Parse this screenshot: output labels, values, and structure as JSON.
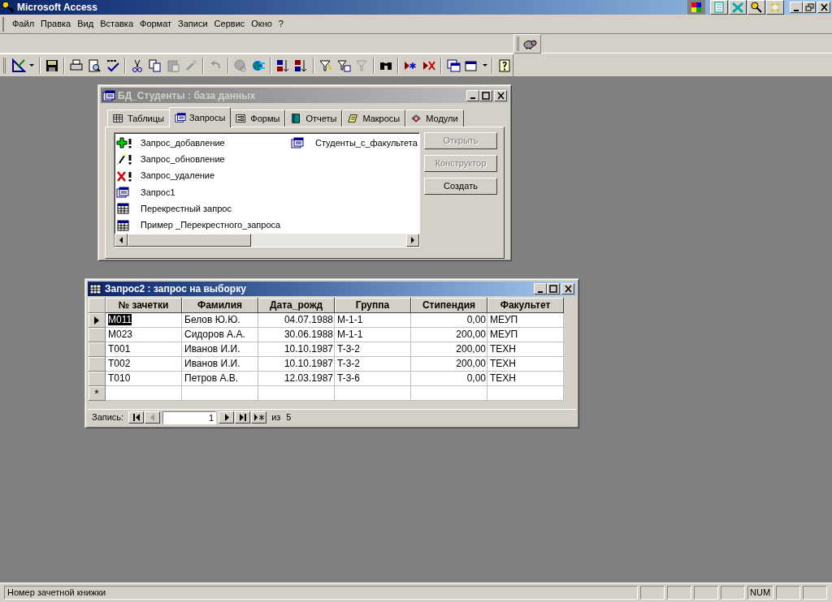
{
  "window": {
    "title": "Microsoft Access"
  },
  "menu": [
    "Файл",
    "Правка",
    "Вид",
    "Вставка",
    "Формат",
    "Записи",
    "Сервис",
    "Окно",
    "?"
  ],
  "db_window": {
    "title": "БД_Студенты : база данных",
    "tabs": [
      {
        "label": "Таблицы",
        "selected": false,
        "kind": "table"
      },
      {
        "label": "Запросы",
        "selected": true,
        "kind": "query"
      },
      {
        "label": "Формы",
        "selected": false,
        "kind": "form"
      },
      {
        "label": "Отчеты",
        "selected": false,
        "kind": "report"
      },
      {
        "label": "Макросы",
        "selected": false,
        "kind": "macro"
      },
      {
        "label": "Модули",
        "selected": false,
        "kind": "module"
      }
    ],
    "objects": [
      {
        "label": "Запрос_добавление",
        "kind": "append"
      },
      {
        "label": "Запрос_обновление",
        "kind": "update"
      },
      {
        "label": "Запрос_удаление",
        "kind": "delete"
      },
      {
        "label": "Запрос1",
        "kind": "select"
      },
      {
        "label": "Перекрестный запрос",
        "kind": "crosstab"
      },
      {
        "label": "Пример _Перекрестного_запроса",
        "kind": "crosstab"
      },
      {
        "label": "Студенты_с_факультета",
        "kind": "select"
      }
    ],
    "buttons": [
      {
        "label": "Открыть",
        "disabled": true
      },
      {
        "label": "Конструктор",
        "disabled": true
      },
      {
        "label": "Создать",
        "disabled": false
      }
    ]
  },
  "query_window": {
    "title": "Запрос2 : запрос на выборку",
    "columns": [
      {
        "label": "№ зачетки",
        "kind": "text"
      },
      {
        "label": "Фамилия",
        "kind": "text"
      },
      {
        "label": "Дата_рожд",
        "kind": "number"
      },
      {
        "label": "Группа",
        "kind": "text"
      },
      {
        "label": "Стипендия",
        "kind": "number"
      },
      {
        "label": "Факультет",
        "kind": "text"
      }
    ],
    "rows": [
      {
        "selected": true,
        "cells": [
          "M011",
          "Белов Ю.Ю.",
          "04.07.1988",
          "M-1-1",
          "0,00",
          "МЕУП"
        ]
      },
      {
        "selected": false,
        "cells": [
          "M023",
          "Сидоров А.А.",
          "30.06.1988",
          "M-1-1",
          "200,00",
          "МЕУП"
        ]
      },
      {
        "selected": false,
        "cells": [
          "T001",
          "Иванов И.И.",
          "10.10.1987",
          "T-3-2",
          "200,00",
          "ТЕХН"
        ]
      },
      {
        "selected": false,
        "cells": [
          "T002",
          "Иванов И.И.",
          "10.10.1987",
          "T-3-2",
          "200,00",
          "ТЕХН"
        ]
      },
      {
        "selected": false,
        "cells": [
          "T010",
          "Петров А.В.",
          "12.03.1987",
          "T-3-6",
          "0,00",
          "ТЕХН"
        ]
      }
    ],
    "new_row_marker": "*",
    "navigator": {
      "label": "Запись:",
      "current": "1",
      "of": "из",
      "total": "5"
    }
  },
  "status_bar": {
    "text": "Номер зачетной книжки",
    "indicator": "NUM"
  }
}
